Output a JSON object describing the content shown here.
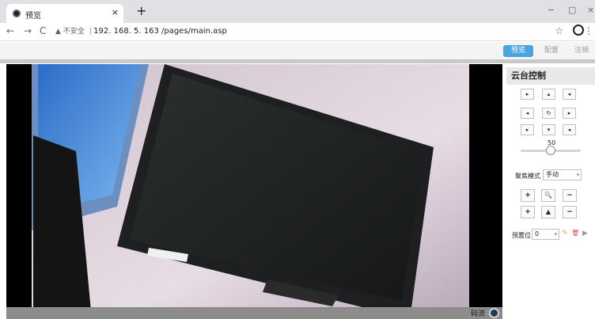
{
  "browser": {
    "tab_title": "预览",
    "tab_close": "×",
    "new_tab": "+",
    "window_controls": {
      "minimize": "−",
      "restore": "▢",
      "close": "×"
    },
    "nav": {
      "back": "←",
      "forward": "→",
      "reload": "C"
    },
    "address": {
      "security_label": "▲ 不安全",
      "separator": "|",
      "url": "192. 168. 5. 163 /pages/main.asp"
    },
    "icons": {
      "favicon": "favicon-icon",
      "star": "☆",
      "menu": "⋮"
    }
  },
  "header": {
    "tabs": [
      {
        "label": "预览",
        "active": true
      },
      {
        "label": "配置",
        "active": false
      },
      {
        "label": "注销",
        "active": false
      }
    ],
    "accent_color": "#4ba3e0"
  },
  "video": {
    "stream_label": "码流"
  },
  "ptz": {
    "title": "云台控制",
    "direction_buttons": [
      {
        "glyph": "▸",
        "icon": "up-left-arrow-icon"
      },
      {
        "glyph": "▴",
        "icon": "up-arrow-icon"
      },
      {
        "glyph": "◂",
        "icon": "up-right-arrow-icon"
      },
      {
        "glyph": "◂",
        "icon": "left-arrow-icon"
      },
      {
        "glyph": "↻",
        "icon": "auto-scan-icon"
      },
      {
        "glyph": "▸",
        "icon": "right-arrow-icon"
      },
      {
        "glyph": "▸",
        "icon": "down-left-arrow-icon"
      },
      {
        "glyph": "▾",
        "icon": "down-arrow-icon"
      },
      {
        "glyph": "◂",
        "icon": "down-right-arrow-icon"
      }
    ],
    "speed": {
      "value": "50",
      "level": 0.5
    },
    "focus": {
      "label": "聚焦模式",
      "selected": "手动",
      "chevron": "▾"
    },
    "zoom": {
      "plus": "+",
      "icon_glyph": "🔍",
      "minus": "−"
    },
    "focus_adjust": {
      "plus": "+",
      "icon_glyph": "▲",
      "minus": "−"
    },
    "preset": {
      "label": "预置位",
      "selected": "0",
      "chevron": "▾",
      "edit_glyph": "✎",
      "delete_glyph": "🗑",
      "call_glyph": "▶"
    }
  }
}
